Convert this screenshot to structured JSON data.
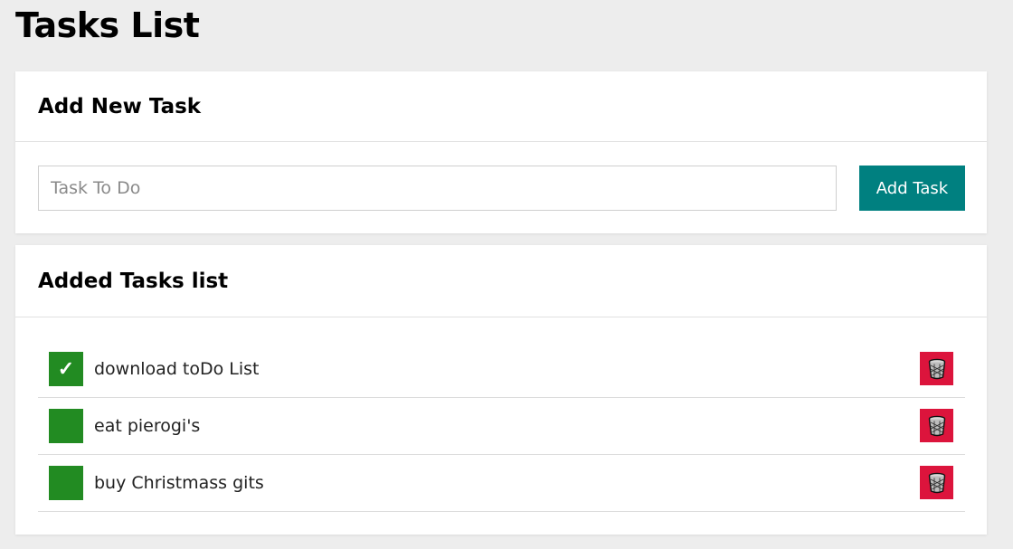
{
  "page": {
    "title": "Tasks List"
  },
  "add_section": {
    "title": "Add New Task",
    "input_placeholder": "Task To Do",
    "input_value": "",
    "button_label": "Add Task"
  },
  "list_section": {
    "title": "Added Tasks list",
    "tasks": [
      {
        "label": "download toDo List",
        "done": true,
        "check_glyph": "✓"
      },
      {
        "label": "eat pierogi's",
        "done": false,
        "check_glyph": ""
      },
      {
        "label": "buy Christmass gits",
        "done": false,
        "check_glyph": ""
      }
    ]
  },
  "icons": {
    "check": "checkmark-icon",
    "delete": "trash-can-icon"
  },
  "colors": {
    "background": "#ededed",
    "accent": "#008080",
    "done_green": "#228b22",
    "delete_red": "#dc143c"
  }
}
